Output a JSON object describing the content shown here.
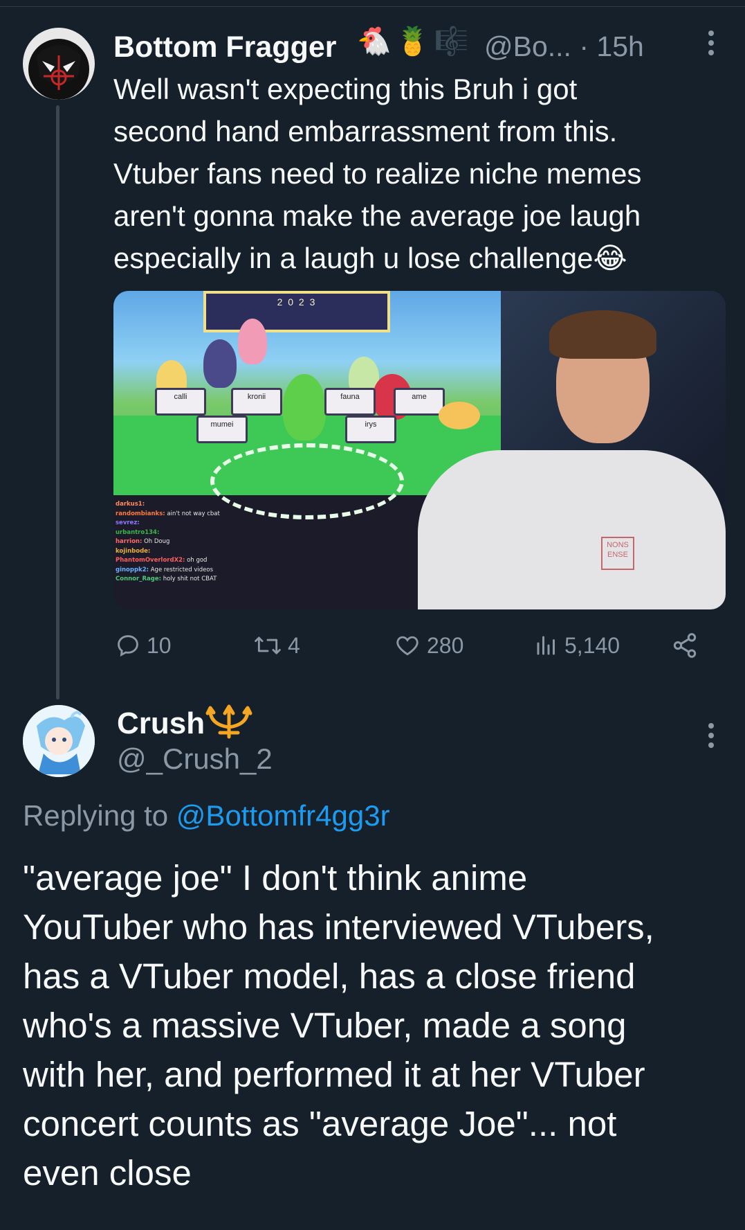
{
  "colors": {
    "background": "#15202b",
    "text": "#f7f9f9",
    "muted": "#8b98a5",
    "link": "#1d9bf0",
    "trident": "#f5a623"
  },
  "tweet": {
    "author_name": "Bottom Fragger",
    "author_emojis": [
      "🐔",
      "🍍",
      "🎼"
    ],
    "handle": "@Bo...",
    "time": "· 15h",
    "text": "Well wasn't expecting this  Bruh i got\nsecond hand embarrassment from this.\nVtuber fans need to realize niche memes\naren't gonna make the average joe laugh\nespecially in a laugh u lose challenge😂",
    "media": {
      "desk_labels": [
        "calli",
        "kronii",
        "fauna",
        "ame",
        "mumei",
        "irys"
      ],
      "banner_text": "2 0 2 3",
      "shirt_text": "NONS ENSE",
      "chat": [
        {
          "user": "darkus1:",
          "msg": ""
        },
        {
          "user": "randombianks:",
          "msg": "ain't not way cbat"
        },
        {
          "user": "sevrez:",
          "msg": ""
        },
        {
          "user": "urbantro134:",
          "msg": ""
        },
        {
          "user": "harrion:",
          "msg": "Oh Doug"
        },
        {
          "user": "kojinbode:",
          "msg": ""
        },
        {
          "user": "PhantomOverlordX2:",
          "msg": "oh god"
        },
        {
          "user": "ginoppk2:",
          "msg": "Age restricted videos"
        },
        {
          "user": "Connor_Rage:",
          "msg": "holy shit not CBAT"
        }
      ]
    },
    "actions": {
      "replies": "10",
      "retweets": "4",
      "likes": "280",
      "views": "5,140"
    },
    "icons": {
      "reply": "reply-icon",
      "retweet": "retweet-icon",
      "like": "heart-icon",
      "views": "views-icon",
      "share": "share-icon",
      "more": "more-icon"
    }
  },
  "reply": {
    "author_name": "Crush",
    "author_emoji": "trident-emoji",
    "handle": "@_Crush_2",
    "replying_prefix": "Replying to ",
    "replying_to": "@Bottomfr4gg3r",
    "text": "\"average joe\"  I don't think anime\nYouTuber who has interviewed VTubers,\nhas a VTuber model, has a close friend\nwho's a massive VTuber, made  a song\nwith her, and performed it at her VTuber\nconcert counts as \"average Joe\"... not\neven close"
  }
}
